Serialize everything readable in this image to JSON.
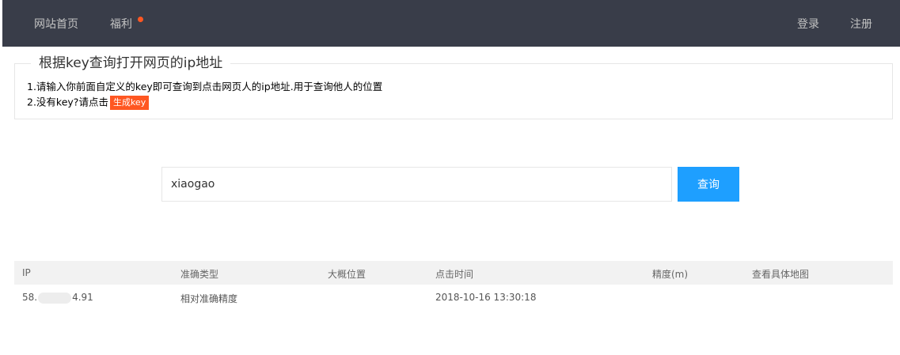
{
  "nav": {
    "home": "网站首页",
    "welfare": "福利",
    "login": "登录",
    "register": "注册"
  },
  "info": {
    "title_pre": "根据",
    "title_key": "key",
    "title_mid": "查询打开网页的",
    "title_ip": "ip",
    "title_post": "地址",
    "line1": "1.请输入你前面自定义的key即可查询到点击网页人的ip地址.用于查询他人的位置",
    "line2": "2.没有key?请点击",
    "generate_button": "生成key"
  },
  "search": {
    "value": "xiaogao",
    "button": "查询"
  },
  "table": {
    "headers": [
      "IP",
      "准确类型",
      "大概位置",
      "点击时间",
      "精度(m)",
      "查看具体地图"
    ],
    "rows": [
      {
        "ip_prefix": "58.",
        "ip_suffix": "4.91",
        "type": "相对准确精度",
        "location": "",
        "time": "2018-10-16 13:30:18",
        "accuracy": "",
        "map": ""
      }
    ]
  },
  "colors": {
    "topbar": "#393d49",
    "accent_orange": "#ff5722",
    "accent_blue": "#1e9fff"
  }
}
